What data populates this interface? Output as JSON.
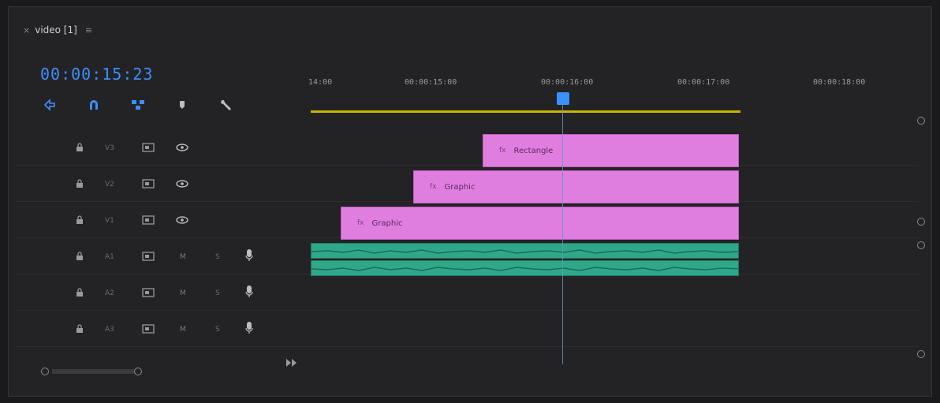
{
  "panel": {
    "tab_title": "video [1]",
    "close_glyph": "×",
    "menu_glyph": "≡"
  },
  "timecode": "00:00:15:23",
  "toolbar": {
    "icons": [
      "nest-sequence-icon",
      "snap-magnet-icon",
      "linked-selection-icon",
      "add-marker-icon",
      "wrench-settings-icon"
    ]
  },
  "ruler": {
    "labels": [
      "14:00",
      "00:00:15:00",
      "00:00:16:00",
      "00:00:17:00",
      "00:00:18:00"
    ]
  },
  "tracks": [
    {
      "name": "V3",
      "kind": "video"
    },
    {
      "name": "V2",
      "kind": "video"
    },
    {
      "name": "V1",
      "kind": "video"
    },
    {
      "name": "A1",
      "kind": "audio",
      "mute": "M",
      "solo": "S"
    },
    {
      "name": "A2",
      "kind": "audio",
      "mute": "M",
      "solo": "S"
    },
    {
      "name": "A3",
      "kind": "audio",
      "mute": "M",
      "solo": "S"
    }
  ],
  "clips": [
    {
      "label": "Rectangle",
      "fx": "fx",
      "track": "V3"
    },
    {
      "label": "Graphic",
      "fx": "fx",
      "track": "V2"
    },
    {
      "label": "Graphic",
      "fx": "fx",
      "track": "V1"
    }
  ],
  "colors": {
    "accent": "#3c8fff",
    "graphic_clip": "#e07ee0",
    "audio_clip": "#2ea889",
    "work_area": "#c8b600"
  }
}
